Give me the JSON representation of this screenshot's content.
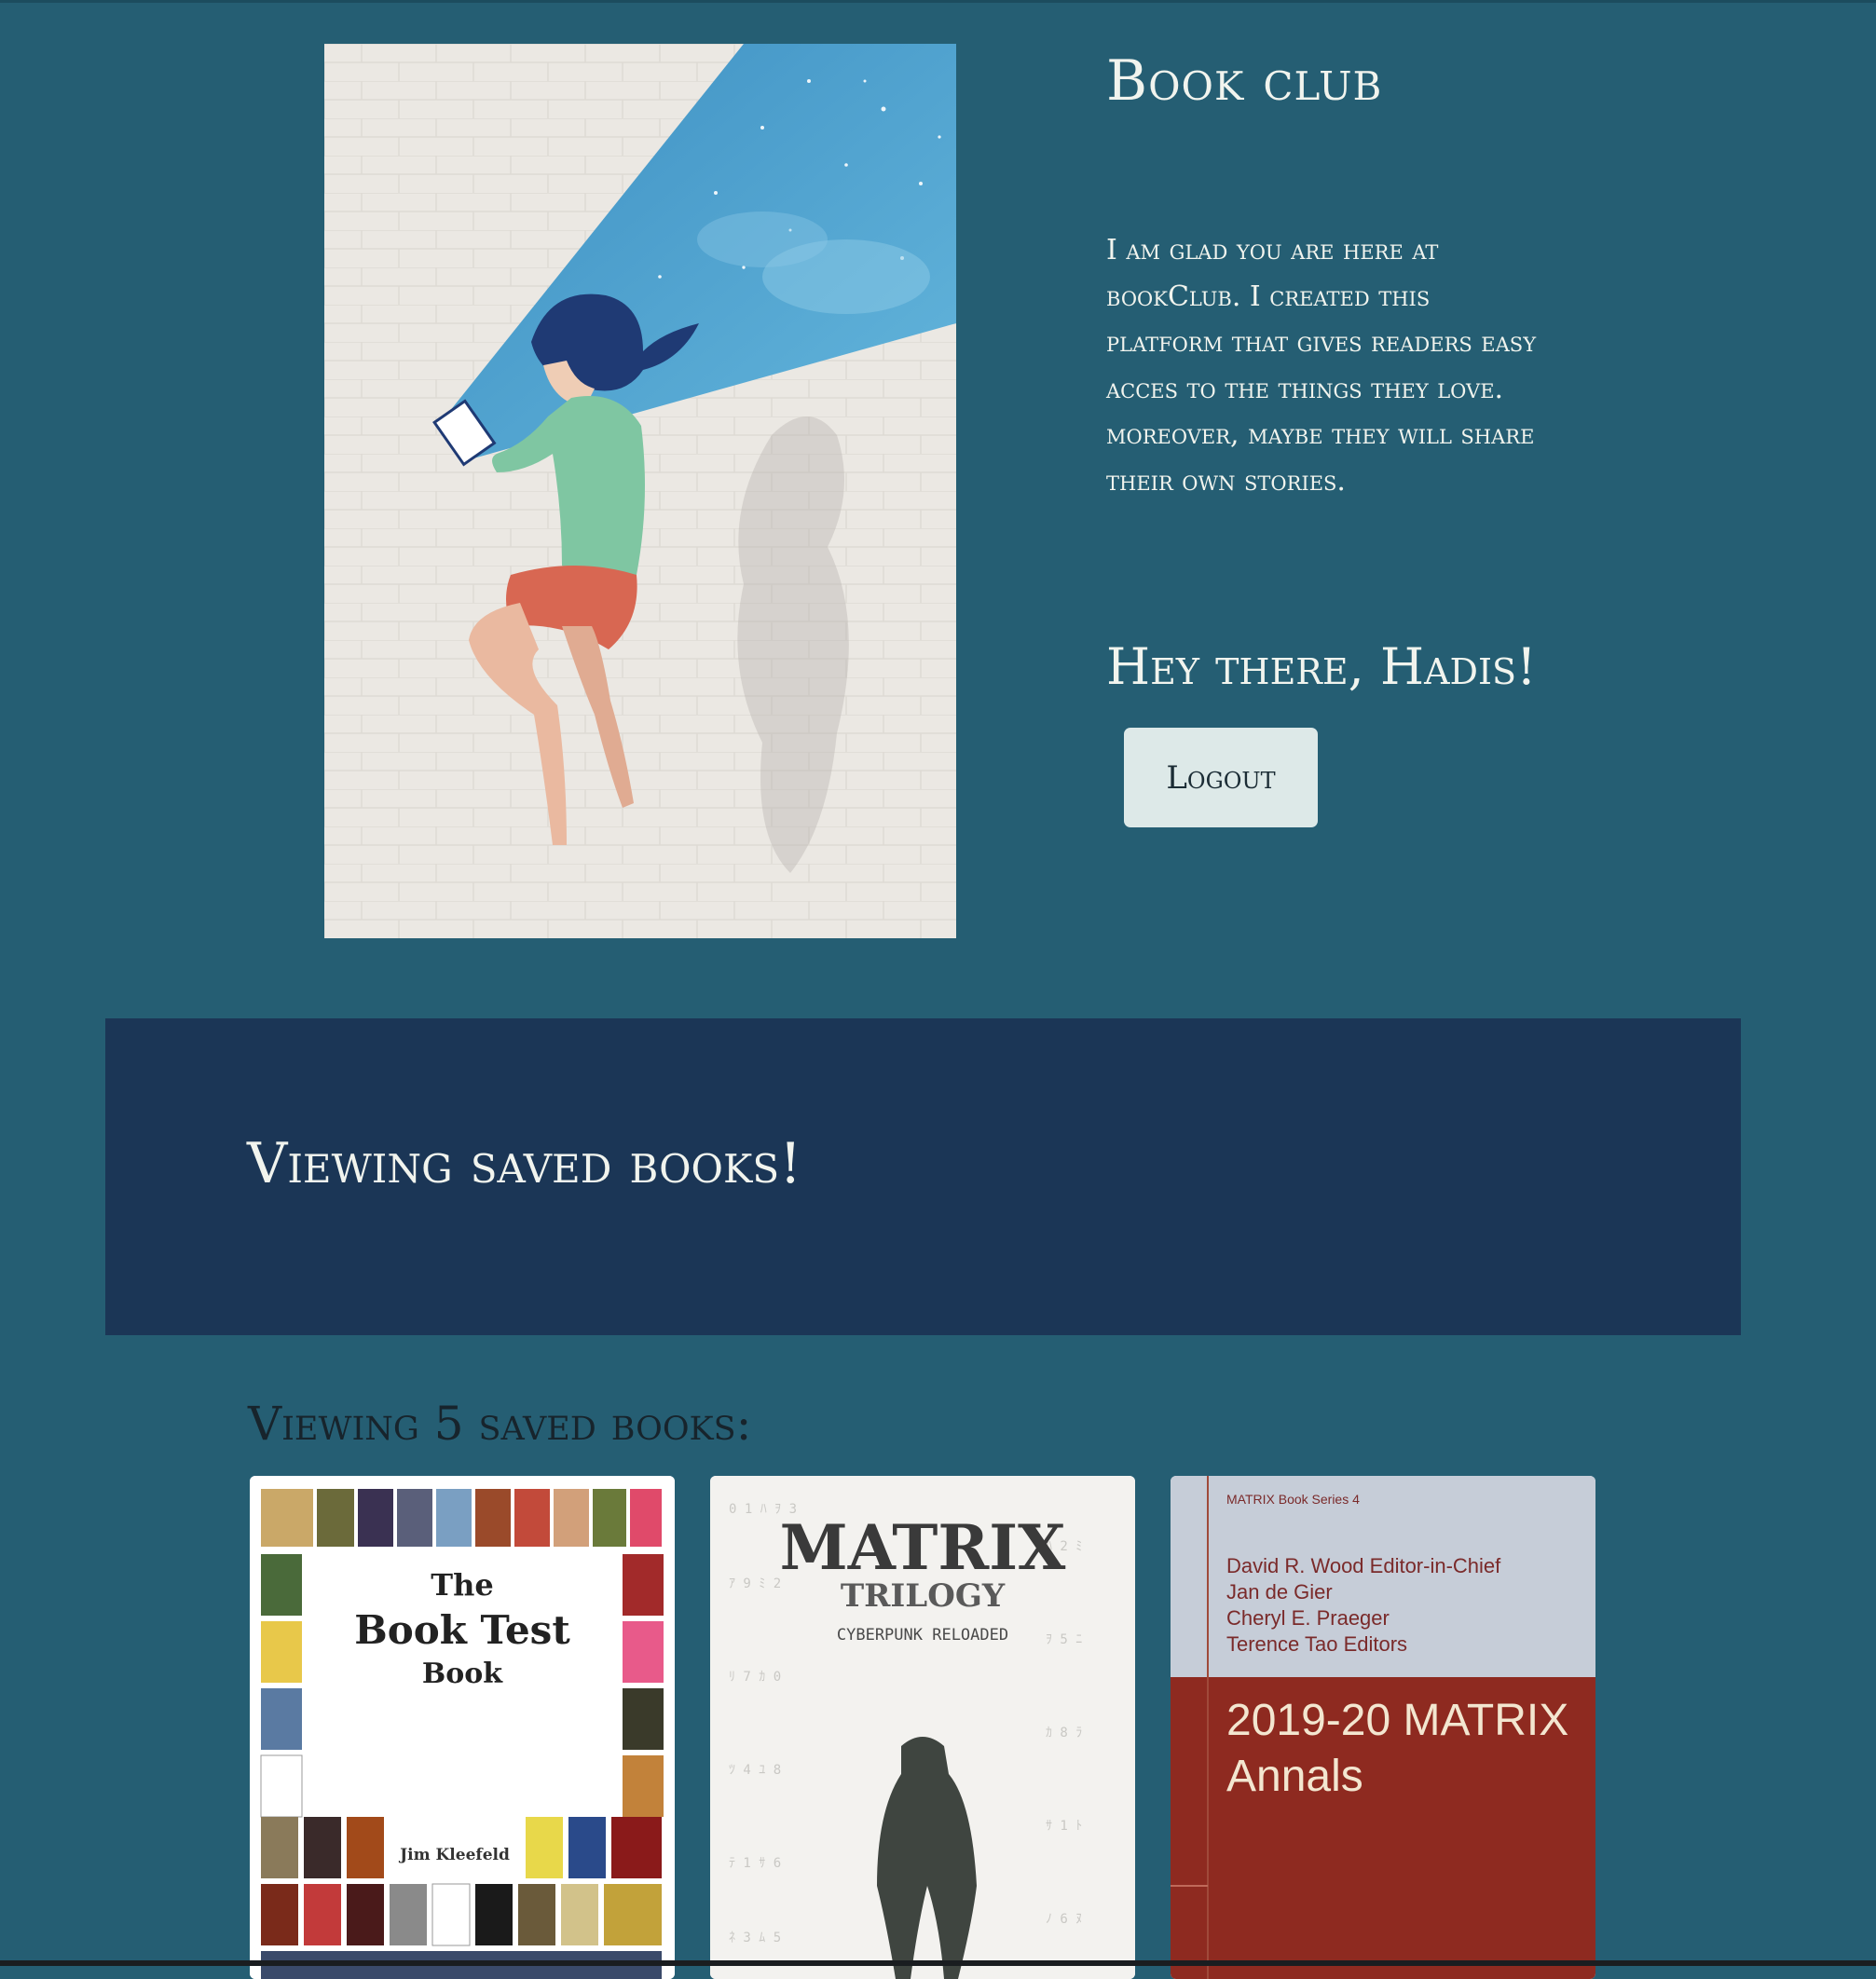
{
  "header": {
    "site_title": "Book club",
    "intro": "I am glad you are here at bookClub. I created this platform that gives readers easy acces to the things they love. moreover, maybe they will share their own stories.",
    "greeting": "Hey there, Hadis!",
    "logout_label": "Logout"
  },
  "hero_image": {
    "icon": "girl-reading-illustration",
    "sky_color": "#4aa3cf",
    "moon_color": "#f2e6a0"
  },
  "banner": {
    "title": "Viewing saved books!"
  },
  "saved": {
    "heading": "Viewing 5 saved books:",
    "books": [
      {
        "cover_title_line1": "The",
        "cover_title_line2": "Book Test",
        "cover_title_line3": "Book",
        "cover_author": "Jim Kleefeld"
      },
      {
        "cover_title": "MATRIX",
        "cover_subtitle": "TRILOGY",
        "cover_tagline": "CYBERPUNK RELOADED"
      },
      {
        "cover_series": "MATRIX Book Series 4",
        "cover_editor_1": "David R. Wood  Editor-in-Chief",
        "cover_editor_2": "Jan de Gier",
        "cover_editor_3": "Cheryl E. Praeger",
        "cover_editor_4": "Terence Tao  Editors",
        "cover_title_line1": "2019-20 MATRIX",
        "cover_title_line2": "Annals"
      }
    ]
  },
  "colors": {
    "page_background": "#255e73",
    "banner_background": "#1b3656",
    "button_background": "#dde9e8"
  }
}
